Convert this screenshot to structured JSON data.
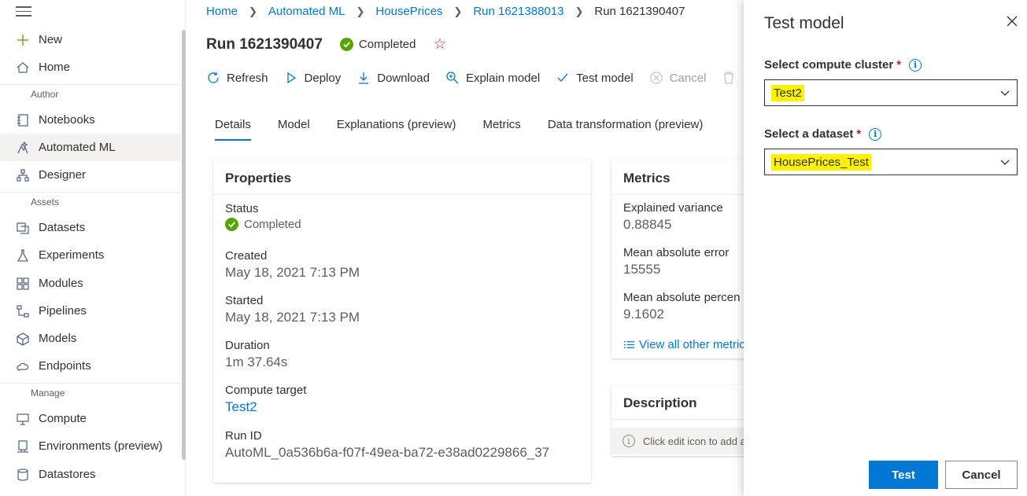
{
  "sidebar": {
    "new_label": "New",
    "home_label": "Home",
    "author_section": "Author",
    "notebooks_label": "Notebooks",
    "automated_ml_label": "Automated ML",
    "designer_label": "Designer",
    "assets_section": "Assets",
    "datasets_label": "Datasets",
    "experiments_label": "Experiments",
    "modules_label": "Modules",
    "pipelines_label": "Pipelines",
    "models_label": "Models",
    "endpoints_label": "Endpoints",
    "manage_section": "Manage",
    "compute_label": "Compute",
    "environments_label": "Environments (preview)",
    "datastores_label": "Datastores"
  },
  "breadcrumb": [
    "Home",
    "Automated ML",
    "HousePrices",
    "Run 1621388013",
    "Run 1621390407"
  ],
  "header": {
    "title": "Run 1621390407",
    "status": "Completed"
  },
  "toolbar": {
    "refresh": "Refresh",
    "deploy": "Deploy",
    "download": "Download",
    "explain_model": "Explain model",
    "test_model": "Test model",
    "cancel": "Cancel"
  },
  "tabs": [
    "Details",
    "Model",
    "Explanations (preview)",
    "Metrics",
    "Data transformation (preview)"
  ],
  "properties": {
    "title": "Properties",
    "status_label": "Status",
    "status_value": "Completed",
    "created_label": "Created",
    "created_value": "May 18, 2021 7:13 PM",
    "started_label": "Started",
    "started_value": "May 18, 2021 7:13 PM",
    "duration_label": "Duration",
    "duration_value": "1m 37.64s",
    "compute_label": "Compute target",
    "compute_value": "Test2",
    "runid_label": "Run ID",
    "runid_value": "AutoML_0a536b6a-f07f-49ea-ba72-e38ad0229866_37"
  },
  "metrics": {
    "title": "Metrics",
    "items": [
      {
        "label": "Explained variance",
        "value": "0.88845"
      },
      {
        "label": "Mean absolute error",
        "value": "15555"
      },
      {
        "label": "Mean absolute percen",
        "value": "9.1602"
      }
    ],
    "view_all": "View all other metric"
  },
  "description": {
    "title": "Description",
    "hint": "Click edit icon to add a"
  },
  "panel": {
    "title": "Test model",
    "cluster_label": "Select compute cluster",
    "cluster_value": "Test2",
    "dataset_label": "Select a dataset",
    "dataset_value": "HousePrices_Test",
    "required_mark": "*",
    "test_button": "Test",
    "cancel_button": "Cancel"
  },
  "colors": {
    "accent": "#0078d4",
    "success": "#57a300",
    "highlight": "#fff200"
  }
}
